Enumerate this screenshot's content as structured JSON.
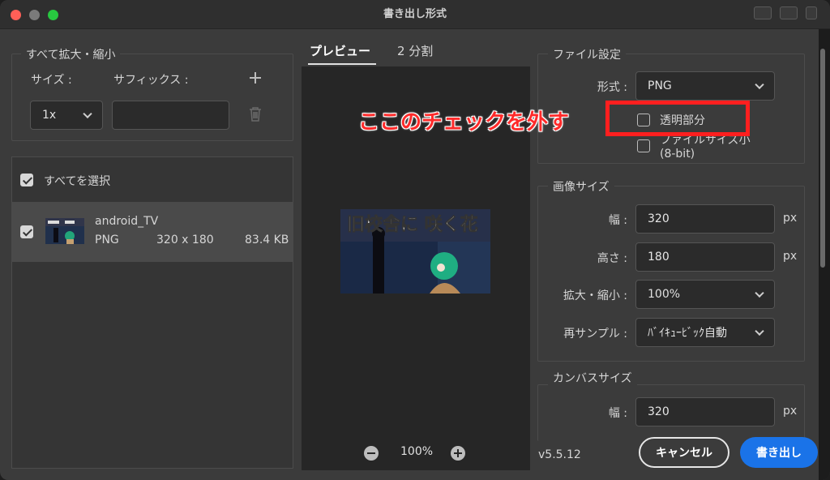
{
  "window": {
    "title": "書き出し形式"
  },
  "left": {
    "scale_group_title": "すべて拡大・縮小",
    "size_label": "サイズ :",
    "suffix_label": "サフィックス :",
    "scale_value": "1x",
    "suffix_value": "",
    "select_all_label": "すべてを選択",
    "asset": {
      "name": "android_TV",
      "format": "PNG",
      "dimensions": "320 x 180",
      "filesize": "83.4 KB"
    }
  },
  "tabs": [
    {
      "label": "プレビュー"
    },
    {
      "label": "2 分割"
    }
  ],
  "preview": {
    "thumb_title": "旧校舎に 咲く花",
    "zoom": "100%"
  },
  "file_settings": {
    "title": "ファイル設定",
    "format_label": "形式 :",
    "format_value": "PNG",
    "transparency_label": "透明部分",
    "smaller_file_label": "ファイルサイズ小",
    "smaller_file_sub": "(8-bit)"
  },
  "image_size": {
    "title": "画像サイズ",
    "width_label": "幅 :",
    "width_value": "320",
    "height_label": "高さ :",
    "height_value": "180",
    "unit": "px",
    "scale_label": "拡大・縮小 :",
    "scale_value": "100%",
    "resample_label": "再サンプル :",
    "resample_value": "ﾊﾞｲｷｭｰﾋﾞｯｸ自動"
  },
  "canvas_size": {
    "title": "カンバスサイズ",
    "width_label": "幅 :",
    "width_value": "320",
    "unit": "px"
  },
  "footer": {
    "version": "v5.5.12",
    "cancel_label": "キャンセル",
    "export_label": "書き出し"
  },
  "annotation": {
    "text": "ここのチェックを外す",
    "color": "#ff2a2a"
  },
  "colors": {
    "accent": "#1a73e8",
    "background": "#3b3b3b",
    "annotation": "#ff1f1f"
  }
}
